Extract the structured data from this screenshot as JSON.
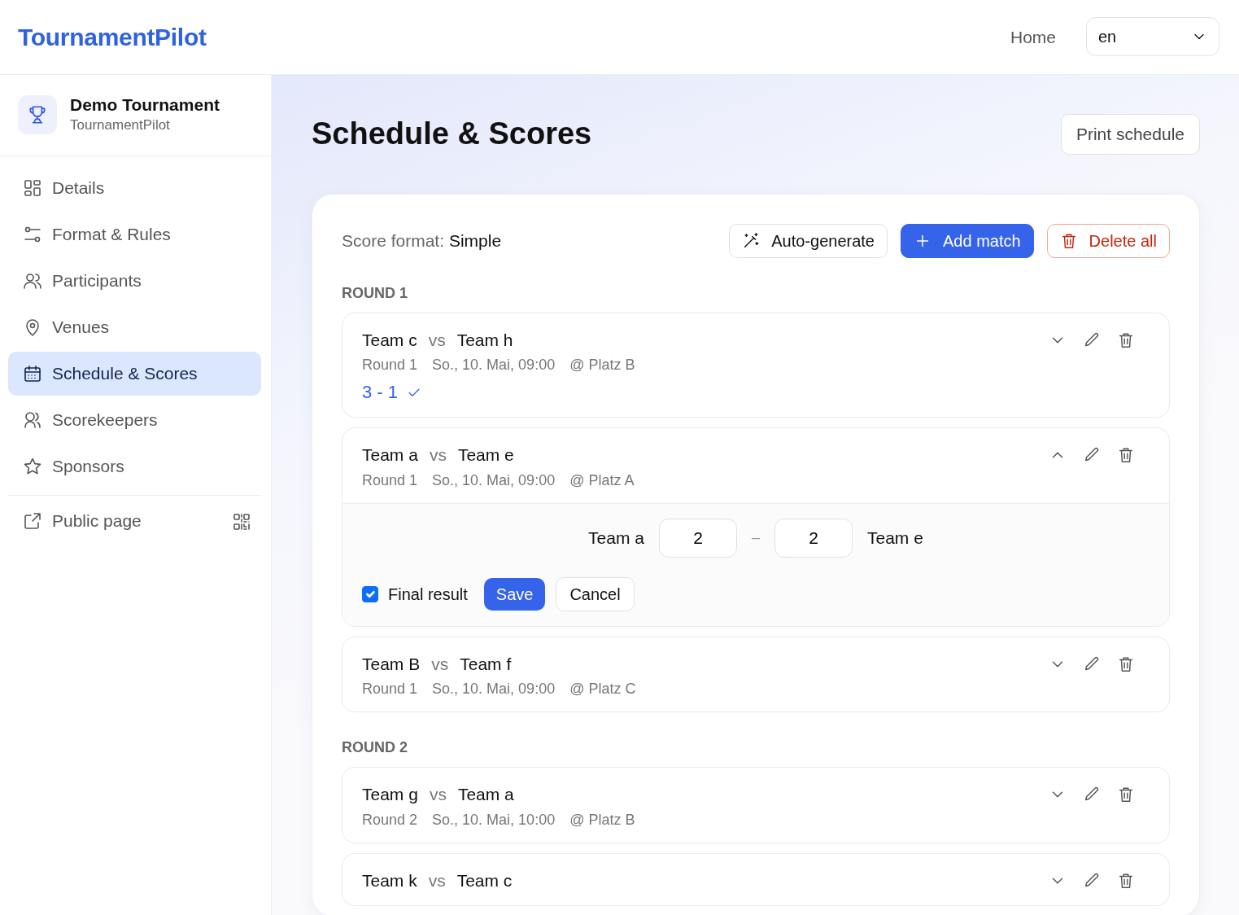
{
  "brand": "TournamentPilot",
  "header": {
    "nav_link": "Home",
    "language": {
      "value": "en"
    }
  },
  "sidebar": {
    "tournament": {
      "name": "Demo Tournament",
      "subtitle": "TournamentPilot"
    },
    "items": [
      {
        "label": "Details",
        "selected": false
      },
      {
        "label": "Format & Rules",
        "selected": false
      },
      {
        "label": "Participants",
        "selected": false
      },
      {
        "label": "Venues",
        "selected": false
      },
      {
        "label": "Schedule & Scores",
        "selected": true
      },
      {
        "label": "Scorekeepers",
        "selected": false
      },
      {
        "label": "Sponsors",
        "selected": false
      }
    ],
    "public_link": {
      "label": "Public page"
    }
  },
  "page": {
    "title": "Schedule & Scores",
    "print_button": "Print schedule"
  },
  "toolbar": {
    "score_format_label": "Score format:",
    "score_format_value": "Simple",
    "buttons": [
      {
        "label": "Auto-generate",
        "kind": "outline"
      },
      {
        "label": "Add match",
        "kind": "primary"
      },
      {
        "label": "Delete all",
        "kind": "danger"
      }
    ]
  },
  "rounds": [
    {
      "title": "ROUND 1",
      "matches": [
        {
          "home": "Team c",
          "vs": "vs",
          "away": "Team h",
          "round": "Round 1",
          "datetime": "So., 10. Mai, 09:00",
          "venue": "@ Platz B",
          "score": "3 - 1",
          "final": true,
          "expanded": false
        },
        {
          "home": "Team a",
          "vs": "vs",
          "away": "Team e",
          "round": "Round 1",
          "datetime": "So., 10. Mai, 09:00",
          "venue": "@ Platz A",
          "expanded": true,
          "editor": {
            "home": "Team a",
            "home_score": "2",
            "separator": "–",
            "away_score": "2",
            "away": "Team e",
            "final_result": {
              "label": "Final result",
              "checked": true
            },
            "save": "Save",
            "cancel": "Cancel"
          }
        },
        {
          "home": "Team B",
          "vs": "vs",
          "away": "Team f",
          "round": "Round 1",
          "datetime": "So., 10. Mai, 09:00",
          "venue": "@ Platz C",
          "expanded": false
        }
      ]
    },
    {
      "title": "ROUND 2",
      "matches": [
        {
          "home": "Team g",
          "vs": "vs",
          "away": "Team a",
          "round": "Round 2",
          "datetime": "So., 10. Mai, 10:00",
          "venue": "@ Platz B",
          "expanded": false
        },
        {
          "home": "Team k",
          "vs": "vs",
          "away": "Team c",
          "expanded": false
        }
      ]
    }
  ]
}
